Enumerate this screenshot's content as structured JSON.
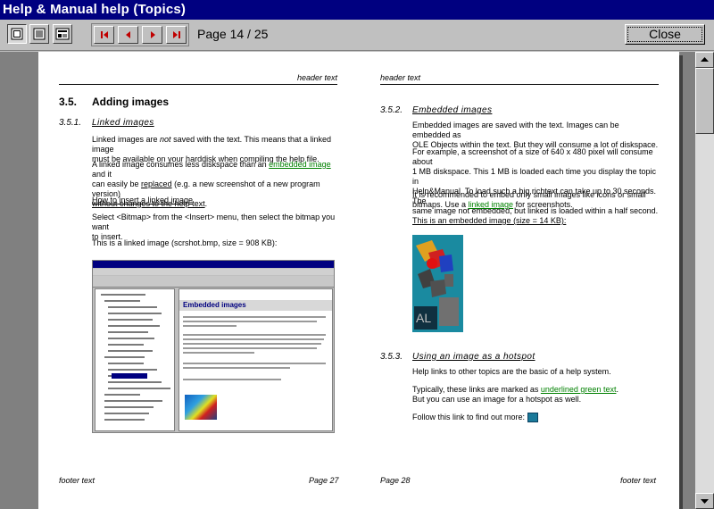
{
  "window": {
    "title": "Help & Manual help (Topics)"
  },
  "toolbar": {
    "page_indicator": "Page 14 / 25",
    "close_label": "Close",
    "view_buttons": [
      "single-page-icon",
      "text-view-icon",
      "page-view-icon"
    ],
    "nav_buttons": [
      "first-page-icon",
      "previous-page-icon",
      "next-page-icon",
      "last-page-icon"
    ]
  },
  "left_page": {
    "header": "header text",
    "section_number": "3.5.",
    "section_title": "Adding images",
    "subsection_number": "3.5.1.",
    "subsection_title": "Linked images",
    "p1a": "Linked images are ",
    "p1_em": "not",
    "p1b": " saved with the text. This means that a linked image",
    "p1c": "must be available on your harddisk when compiling the help file.",
    "p2a": "A linked image consumes less diskspace than an ",
    "p2_link": "embedded image",
    "p2b": " and it",
    "p2c": "can easily be ",
    "p2_u1": "replaced",
    "p2d": " (e.g. a new screenshot of a new program version)",
    "p2_u2": "without changes to the help text",
    "p2e": ".",
    "howto": "How to insert a linked image",
    "p3a": "Select <Bitmap> from the <Insert> menu, then select the bitmap you want",
    "p3b": "to insert.",
    "p4": "This is a linked image (scrshot.bmp, size = 908 KB):",
    "shot_heading": "Embedded images",
    "footer_left": "footer text",
    "footer_page": "Page 27"
  },
  "right_page": {
    "header": "header text",
    "subsection_number": "3.5.2.",
    "subsection_title": "Embedded images",
    "p1a": "Embedded images are saved with the text. Images can be embedded as",
    "p1b": "OLE Objects within the text. But they will consume a lot of diskspace.",
    "p2a": "For example, a screenshot of a size of 640 x 480 pixel will consume about",
    "p2b": "1 MB diskspace. This 1 MB is loaded each time you display the topic in",
    "p2c": "Help&Manual. To load such a big richtext can take up to 30 seconds. The",
    "p2d": "same image not embedded, but linked is loaded within a half second.",
    "p3a": "It is recommended to embed only small images like icons or small",
    "p3b": "bitmaps. Use a ",
    "p3_link": "linked image",
    "p3c": " for screenshots.",
    "caption": "This is an embedded image (size = 14 KB):",
    "sub2_number": "3.5.3.",
    "sub2_title": "Using an image as a hotspot",
    "p4": "Help links to other topics are the basic of a help system.",
    "p5a": "Typically, these links are marked as ",
    "p5_link": "underlined green text",
    "p5b": ".",
    "p5c": "But you can use an image for a hotspot as well.",
    "p6": "Follow this link to find out more: ",
    "footer_page": "Page 28",
    "footer_right": "footer text"
  },
  "colors": {
    "title_bg": "#000080",
    "link": "#008000",
    "nav_arrow": "#c00000"
  }
}
